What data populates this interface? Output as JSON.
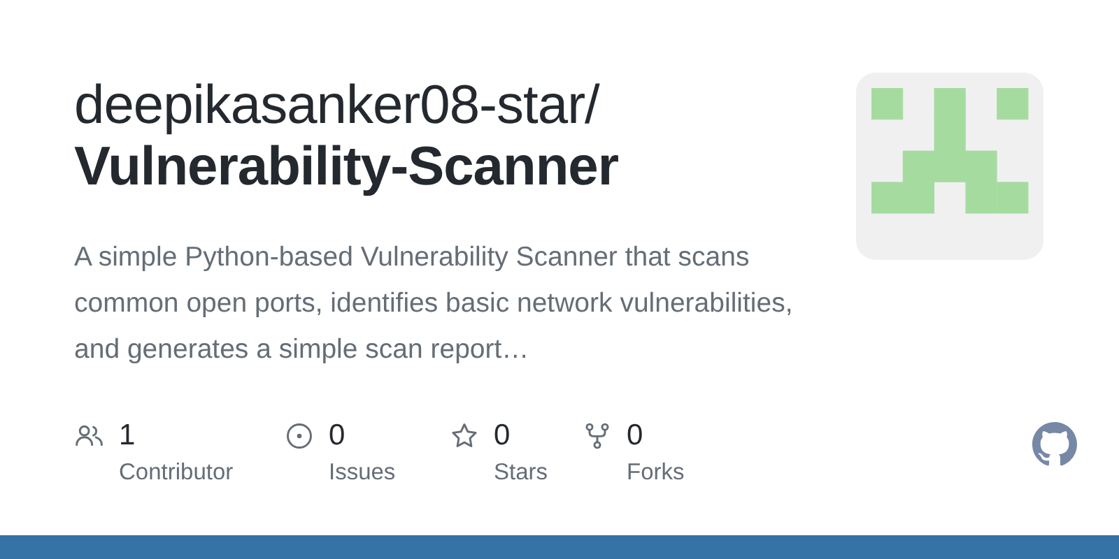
{
  "repo": {
    "owner": "deepikasanker08-star/",
    "name": "Vulnerability-Scanner"
  },
  "description": "A simple Python-based Vulnerability Scanner that scans common open ports, identifies basic network vulnerabilities, and generates a simple scan report…",
  "stats": [
    {
      "kind": "contributors",
      "count": "1",
      "label": "Contributor"
    },
    {
      "kind": "issues",
      "count": "0",
      "label": "Issues"
    },
    {
      "kind": "stars",
      "count": "0",
      "label": "Stars"
    },
    {
      "kind": "forks",
      "count": "0",
      "label": "Forks"
    }
  ],
  "language_bar": {
    "color": "#3572a5"
  }
}
